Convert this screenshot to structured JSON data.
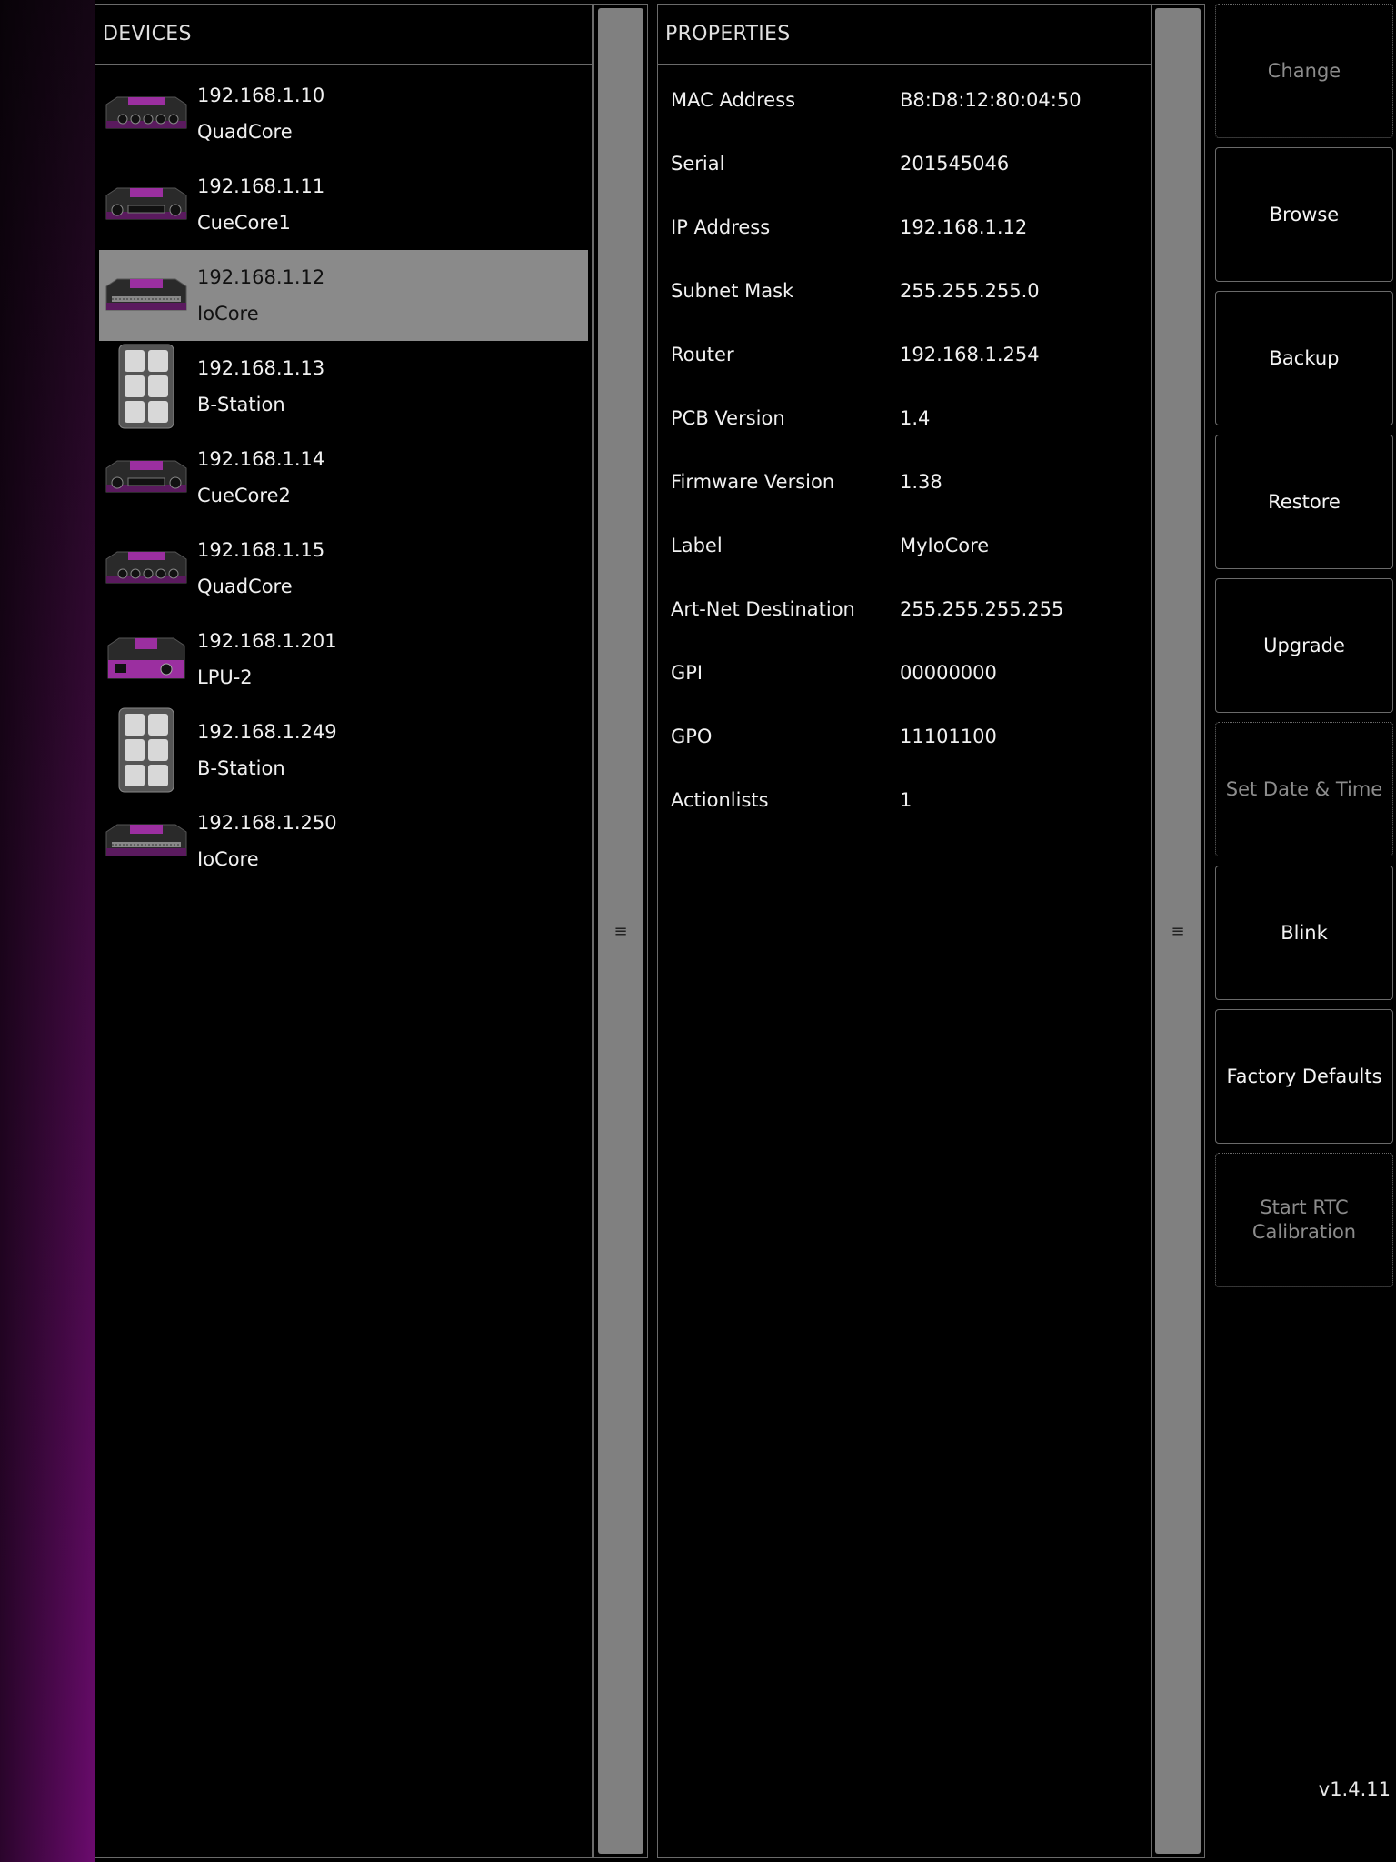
{
  "devices": {
    "title": "DEVICES",
    "items": [
      {
        "ip": "192.168.1.10",
        "name": "QuadCore",
        "icon": "quadcore-device-icon"
      },
      {
        "ip": "192.168.1.11",
        "name": "CueCore1",
        "icon": "cuecore-device-icon"
      },
      {
        "ip": "192.168.1.12",
        "name": "IoCore",
        "icon": "iocore-device-icon",
        "selected": true
      },
      {
        "ip": "192.168.1.13",
        "name": "B-Station",
        "icon": "bstation-device-icon"
      },
      {
        "ip": "192.168.1.14",
        "name": "CueCore2",
        "icon": "cuecore-device-icon"
      },
      {
        "ip": "192.168.1.15",
        "name": "QuadCore",
        "icon": "quadcore-device-icon"
      },
      {
        "ip": "192.168.1.201",
        "name": "LPU-2",
        "icon": "lpu-device-icon"
      },
      {
        "ip": "192.168.1.249",
        "name": "B-Station",
        "icon": "bstation-device-icon"
      },
      {
        "ip": "192.168.1.250",
        "name": "IoCore",
        "icon": "iocore-device-icon"
      }
    ]
  },
  "properties": {
    "title": "PROPERTIES",
    "rows": [
      {
        "key": "MAC Address",
        "value": "B8:D8:12:80:04:50"
      },
      {
        "key": "Serial",
        "value": "201545046"
      },
      {
        "key": "IP Address",
        "value": "192.168.1.12"
      },
      {
        "key": "Subnet Mask",
        "value": "255.255.255.0"
      },
      {
        "key": "Router",
        "value": "192.168.1.254"
      },
      {
        "key": "PCB Version",
        "value": "1.4"
      },
      {
        "key": "Firmware Version",
        "value": "1.38"
      },
      {
        "key": "Label",
        "value": "MyIoCore"
      },
      {
        "key": "Art-Net Destination",
        "value": "255.255.255.255"
      },
      {
        "key": "GPI",
        "value": "00000000"
      },
      {
        "key": "GPO",
        "value": "11101100"
      },
      {
        "key": "Actionlists",
        "value": "1"
      }
    ]
  },
  "scroll_handle_glyph": "≡",
  "actions": [
    {
      "label": "Change",
      "enabled": false
    },
    {
      "label": "Browse",
      "enabled": true
    },
    {
      "label": "Backup",
      "enabled": true
    },
    {
      "label": "Restore",
      "enabled": true
    },
    {
      "label": "Upgrade",
      "enabled": true
    },
    {
      "label": "Set Date & Time",
      "enabled": false
    },
    {
      "label": "Blink",
      "enabled": true
    },
    {
      "label": "Factory Defaults",
      "enabled": true
    },
    {
      "label": "Start RTC Calibration",
      "enabled": false
    }
  ],
  "version": "v1.4.11",
  "colors": {
    "accent_purple": "#9b2fa0",
    "selected_row": "#8a8a8a",
    "border": "#6a6a6a",
    "disabled_text": "#8c8c8c"
  }
}
